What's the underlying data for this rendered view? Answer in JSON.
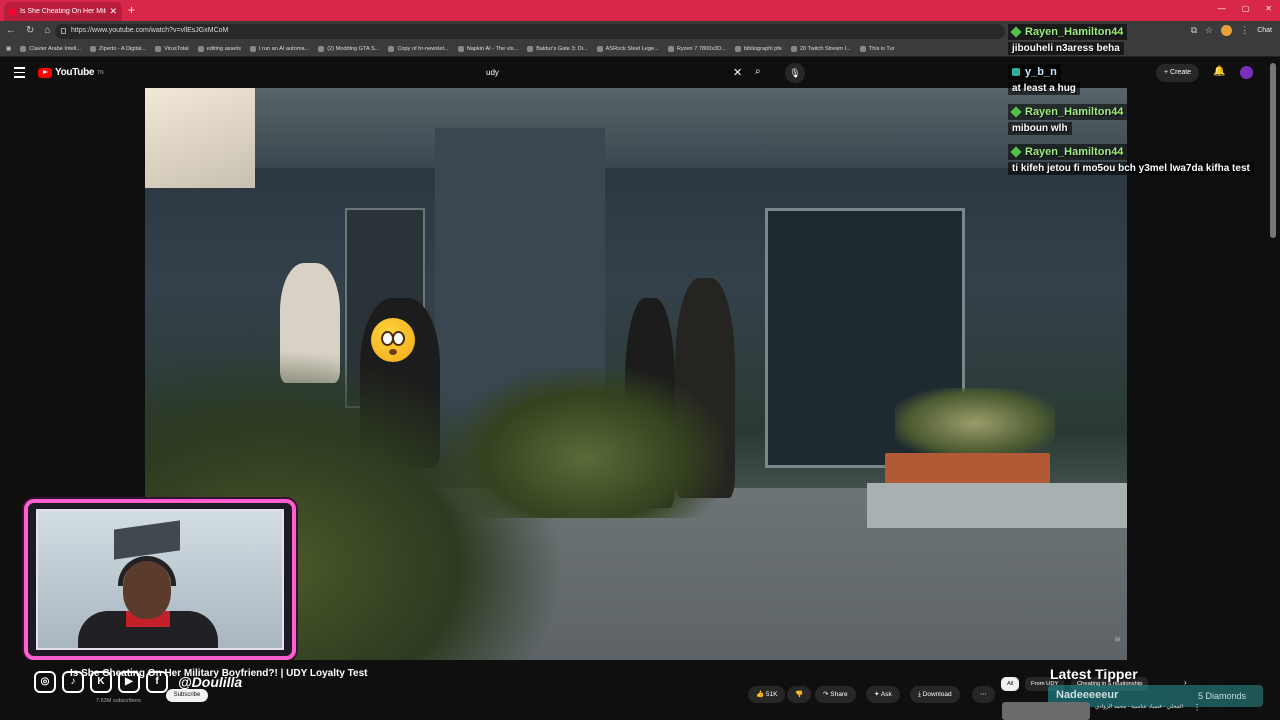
{
  "browser": {
    "tab_title": "Is She Cheating On Her Military B",
    "url": "https://www.youtube.com/watch?v=vllEsJGxMCoM",
    "chat_label": "Chat"
  },
  "bookmarks": [
    "Clavier Arabe Intell...",
    "Ziperto - A Digital...",
    "VirusTotal",
    "editing assets",
    "I run an AI automa...",
    "(2) Modding GTA S...",
    "Copy of hr-newslet...",
    "Napkin AI - The vis...",
    "Baldur's Gate 3: Di...",
    "ASRock Steel Lege...",
    "Ryzen 7 7800x3D...",
    "bibliographi pfe",
    "20 Twitch Stream I...",
    "This is Tur"
  ],
  "youtube": {
    "logo_text": "YouTube",
    "logo_sup": "TN",
    "search_value": "udy",
    "create_label": "Create"
  },
  "chat": [
    {
      "user": "Rayen_Hamilton44",
      "text": "jibouheli n3aress beha"
    },
    {
      "user": "y_b_n",
      "text": "at least a hug"
    },
    {
      "user": "Rayen_Hamilton44",
      "text": "miboun wlh"
    },
    {
      "user": "Rayen_Hamilton44",
      "text": "ti kifeh jetou fi mo5ou bch y3mel lwa7da kifha test"
    }
  ],
  "video": {
    "title": "Is She Cheating On Her Military Boyfriend?! | UDY Loyalty Test",
    "subscribers": "7.63M subscribers",
    "subscribe_label": "Subscribe",
    "like_count": "51K",
    "share_label": "Share",
    "ask_label": "Ask",
    "download_label": "Download"
  },
  "overlay": {
    "social_handle": "@Doulilla",
    "latest_tipper_label": "Latest Tipper",
    "tipper_name": "Nadeeeeeur",
    "tipper_amount": "5 Diamonds"
  },
  "chips": [
    "All",
    "From UDY",
    "Cheating in a relationship"
  ],
  "related_title": "المحلي - فسياد عناسية - محمد الروادي"
}
